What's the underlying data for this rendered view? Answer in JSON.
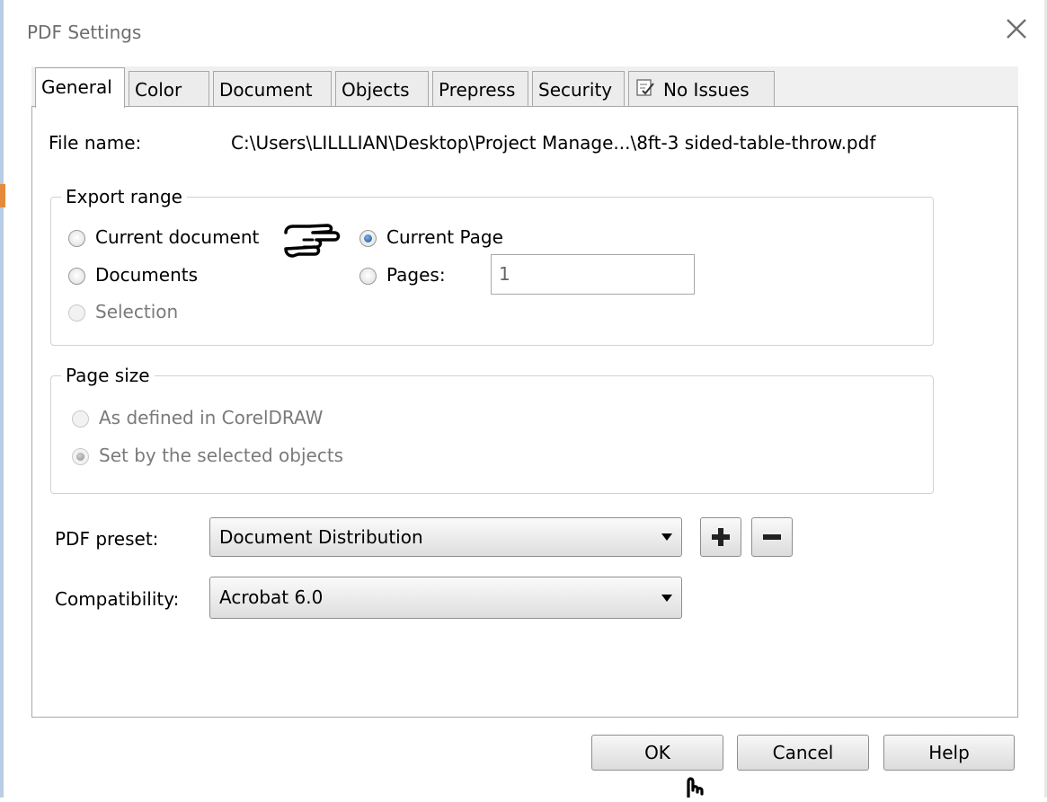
{
  "window": {
    "title": "PDF Settings"
  },
  "icons": {
    "close": "close-icon",
    "no_issues": "checklist-icon",
    "pointer_hand": "hand-pointer-icon",
    "cursor": "hand-cursor-icon",
    "plus": "plus-icon",
    "minus": "minus-icon"
  },
  "tabs": [
    {
      "label": "General",
      "active": true
    },
    {
      "label": "Color"
    },
    {
      "label": "Document"
    },
    {
      "label": "Objects"
    },
    {
      "label": "Prepress"
    },
    {
      "label": "Security"
    },
    {
      "label": "No Issues"
    }
  ],
  "file": {
    "label": "File name:",
    "value": "C:\\Users\\LILLLIAN\\Desktop\\Project Manage...\\8ft-3 sided-table-throw.pdf"
  },
  "export_range": {
    "legend": "Export range",
    "current_document": "Current document",
    "documents": "Documents",
    "selection": "Selection",
    "current_page": "Current Page",
    "pages": "Pages:",
    "pages_value": "1",
    "selected": "Current Page"
  },
  "page_size": {
    "legend": "Page size",
    "as_defined": "As defined in CorelDRAW",
    "set_by_selected": "Set by the selected objects",
    "selected": "Set by the selected objects"
  },
  "preset": {
    "label": "PDF preset:",
    "value": "Document Distribution"
  },
  "compatibility": {
    "label": "Compatibility:",
    "value": "Acrobat 6.0"
  },
  "buttons": {
    "ok": "OK",
    "cancel": "Cancel",
    "help": "Help"
  },
  "colors": {
    "accent": "#1b4f8a",
    "window_bg": "#ffffff",
    "tab_bg": "#ececec",
    "border": "#a8a8a8",
    "left_accent": "#e58a3a"
  }
}
